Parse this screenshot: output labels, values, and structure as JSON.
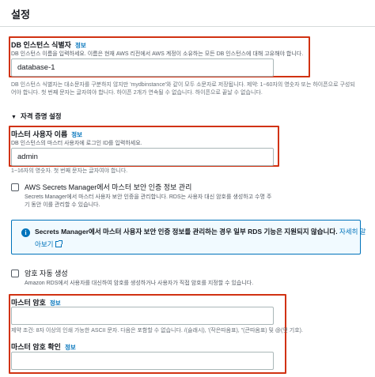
{
  "page": {
    "title": "설정"
  },
  "db_identifier": {
    "label": "DB 인스턴스 식별자",
    "info": "정보",
    "description": "DB 인스턴스 이름을 입력하세요. 이름은 현재 AWS 리전에서 AWS 계정이 소유하는 모든 DB 인스턴스에 대해 고유해야 합니다.",
    "value": "database-1",
    "hint_line1": "DB 인스턴스 식별자는 대소문자를 구분하지 않지만 'mydbinstance'와 같이 모두 소문자로 저장됩니다. 제약: 1~60자의 영숫자 또는 하이픈으로 구성되",
    "hint_line2": "어야 합니다. 첫 번째 문자는 글자여야 합니다. 하이픈 2개가 연속될 수 없습니다. 하이픈으로 끝날 수 없습니다."
  },
  "credentials_section": {
    "title": "자격 증명 설정",
    "caret": "▼"
  },
  "master_username": {
    "label": "마스터 사용자 이름",
    "info": "정보",
    "description": "DB 인스턴스의 마스터 사용자에 로그인 ID를 입력하세요.",
    "value": "admin",
    "hint": "1~16자의 영숫자. 첫 번째 문자는 글자여야 합니다."
  },
  "secrets_manager": {
    "label": "AWS Secrets Manager에서 마스터 보안 인증 정보 관리",
    "description_line1": "Secrets Manager에서 마스터 사용자 보안 인증을 관리합니다. RDS는 사용자 대신 암호를 생성하고 수명 주",
    "description_line2": "기 동안 이를 관리할 수 있습니다.",
    "checked": false
  },
  "alert": {
    "icon": "i",
    "text": "Secrets Manager에서 마스터 사용자 보안 인증 정보를 관리하는 경우 일부 RDS 기능은 지원되지 않습니다.",
    "link_part1": "자세히 알",
    "link_part2": "아보기"
  },
  "auto_password": {
    "label": "암호 자동 생성",
    "description": "Amazon RDS에서 사용자를 대신하여 암호를 생성하거나 사용자가 직접 암호를 지정할 수 있습니다.",
    "checked": false
  },
  "master_password": {
    "label": "마스터 암호",
    "info": "정보",
    "value": "",
    "hint": "제약 조건: 8자 이상의 인쇄 가능한 ASCII 문자. 다음은 포함할 수 없습니다. /(슬래시), '(작은따옴표), \"(큰따옴표) 및 @(앳 기호)."
  },
  "confirm_password": {
    "label": "마스터 암호 확인",
    "info": "정보",
    "value": ""
  },
  "colors": {
    "highlight": "#d13212",
    "link": "#0073bb",
    "alert_bg": "#f1faff"
  }
}
